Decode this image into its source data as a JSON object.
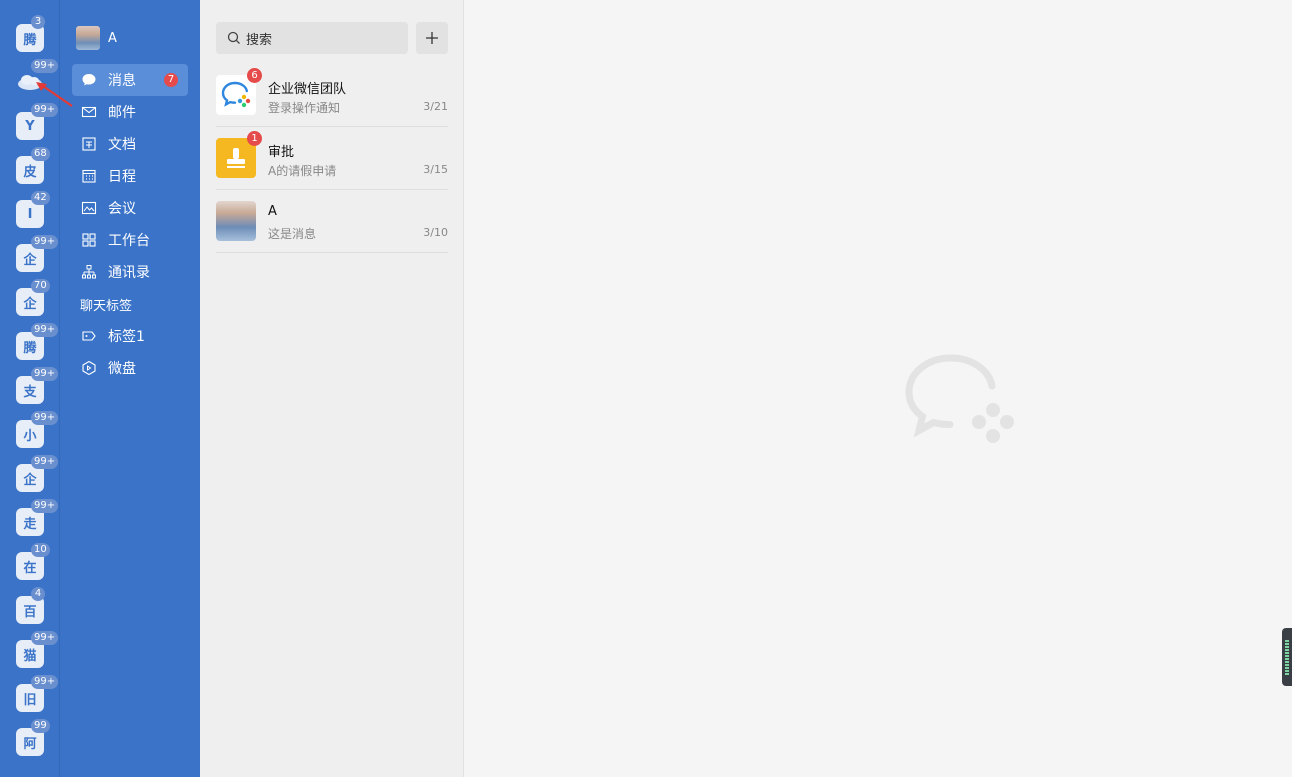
{
  "accounts": [
    {
      "label": "腾",
      "badge": "3"
    },
    {
      "label": "",
      "badge": "99+"
    },
    {
      "label": "Y",
      "badge": "99+"
    },
    {
      "label": "皮",
      "badge": "68"
    },
    {
      "label": "I",
      "badge": "42"
    },
    {
      "label": "企",
      "badge": "99+"
    },
    {
      "label": "企",
      "badge": "70"
    },
    {
      "label": "腾",
      "badge": "99+"
    },
    {
      "label": "支",
      "badge": "99+"
    },
    {
      "label": "小",
      "badge": "99+"
    },
    {
      "label": "企",
      "badge": "99+"
    },
    {
      "label": "走",
      "badge": "99+"
    },
    {
      "label": "在",
      "badge": "10"
    },
    {
      "label": "百",
      "badge": "4"
    },
    {
      "label": "猫",
      "badge": "99+"
    },
    {
      "label": "旧",
      "badge": "99+"
    },
    {
      "label": "阿",
      "badge": "99"
    }
  ],
  "profile": {
    "name": "A"
  },
  "nav": {
    "messages": {
      "label": "消息",
      "count": "7",
      "icon": "chat-bubble-icon"
    },
    "mail": {
      "label": "邮件",
      "icon": "mail-icon"
    },
    "docs": {
      "label": "文档",
      "icon": "document-icon"
    },
    "calendar": {
      "label": "日程",
      "icon": "calendar-icon"
    },
    "meeting": {
      "label": "会议",
      "icon": "meeting-icon"
    },
    "workbench": {
      "label": "工作台",
      "icon": "grid-icon"
    },
    "contacts": {
      "label": "通讯录",
      "icon": "org-chart-icon"
    },
    "chat_tags_section": "聊天标签",
    "tag1": {
      "label": "标签1",
      "icon": "tag-icon"
    },
    "drive": {
      "label": "微盘",
      "icon": "cube-icon"
    }
  },
  "search": {
    "placeholder": "搜索"
  },
  "conversations": [
    {
      "title": "企业微信团队",
      "preview": "登录操作通知",
      "date": "3/21",
      "unread": "6"
    },
    {
      "title": "审批",
      "preview": "A的请假申请",
      "date": "3/15",
      "unread": "1"
    },
    {
      "title": "A",
      "preview": "这是消息",
      "date": "3/10",
      "unread": ""
    }
  ],
  "colors": {
    "sidebar": "#3a73c8",
    "active_item": "#5b8ed8",
    "badge_red": "#e64b4b",
    "approval_yellow": "#f5b820"
  }
}
